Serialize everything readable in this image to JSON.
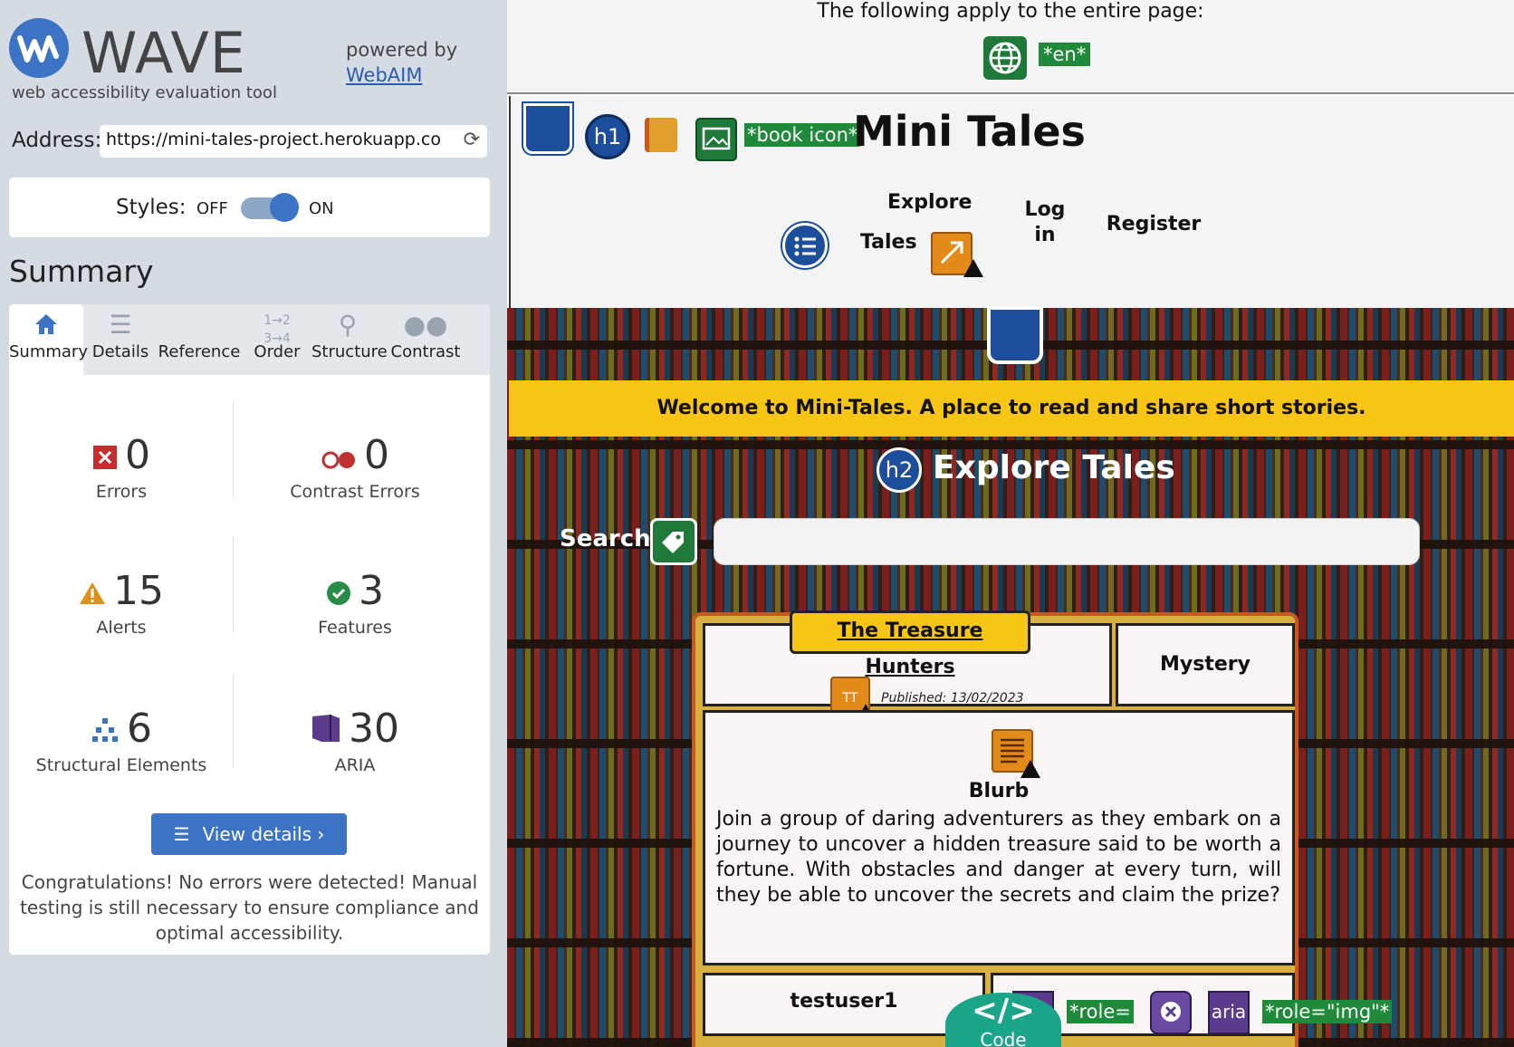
{
  "wave": {
    "logo_text": "WAVE",
    "tagline": "web accessibility evaluation tool",
    "powered_by": "powered by",
    "webaim_link": "WebAIM",
    "address_label": "Address:",
    "address_value": "https://mini-tales-project.herokuapp.com",
    "styles_label": "Styles:",
    "styles_off": "OFF",
    "styles_on": "ON",
    "styles_state": "on",
    "summary_heading": "Summary",
    "tabs": [
      {
        "label": "Summary",
        "icon": "home-icon",
        "active": true
      },
      {
        "label": "Details",
        "icon": "list-icon",
        "active": false
      },
      {
        "label": "Reference",
        "icon": "info-icon",
        "active": false
      },
      {
        "label": "Order",
        "icon": "order-icon",
        "active": false
      },
      {
        "label": "Structure",
        "icon": "structure-icon",
        "active": false
      },
      {
        "label": "Contrast",
        "icon": "contrast-icon",
        "active": false
      }
    ],
    "stats": {
      "errors": {
        "value": "0",
        "label": "Errors"
      },
      "contrast_errors": {
        "value": "0",
        "label": "Contrast Errors"
      },
      "alerts": {
        "value": "15",
        "label": "Alerts"
      },
      "features": {
        "value": "3",
        "label": "Features"
      },
      "structural": {
        "value": "6",
        "label": "Structural Elements"
      },
      "aria": {
        "value": "30",
        "label": "ARIA"
      }
    },
    "view_details": "View details ›",
    "congrats": "Congratulations! No errors were detected! Manual testing is still necessary to ensure compliance and optimal accessibility.",
    "colors": {
      "accent": "#3d73c4",
      "error": "#c03030",
      "alert": "#e0901a",
      "feature": "#2a8a48",
      "aria": "#5a3b8c"
    }
  },
  "page": {
    "apply_text": "The following apply to the entire page:",
    "lang_badge": "*en*",
    "book_icon_tag": "*book icon*",
    "site_title": "Mini Tales",
    "h1_badge": "h1",
    "h2_badge": "h2",
    "nav": {
      "explore_line1": "Explore",
      "explore_line2": "Tales",
      "login_line1": "Log",
      "login_line2": "in",
      "register": "Register"
    },
    "banner": "Welcome to Mini-Tales. A place to read and share short stories.",
    "explore_heading": "Explore Tales",
    "search_label": "Search:",
    "search_value": "",
    "story": {
      "title": "The Treasure Hunters",
      "published": "Published: 13/02/2023",
      "genre": "Mystery",
      "tt_icon": "TT",
      "blurb_title": "Blurb",
      "blurb": "Join a group of daring adventurers as they embark on a journey to uncover a hidden treasure said to be worth a fortune. With obstacles and danger at every turn, will they be able to uncover the secrets and claim the prize?",
      "author": "testuser1"
    },
    "bottom_tags": {
      "aria_1": "aria",
      "role_1": "*role=",
      "aria_2": "aria",
      "role_img": "*role=\"img\"*"
    },
    "code_button": {
      "glyph": "</>",
      "label": "Code"
    }
  }
}
